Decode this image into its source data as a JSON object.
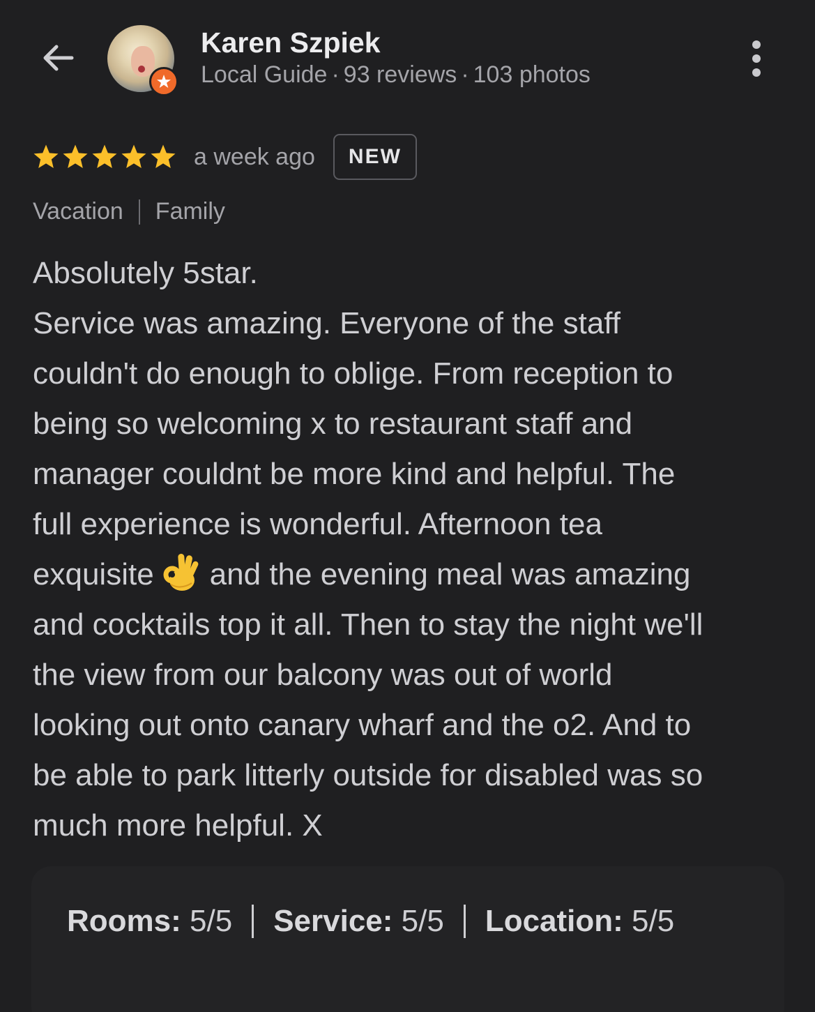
{
  "header": {
    "reviewer_name": "Karen Szpiek",
    "guide_label": "Local Guide",
    "reviews_count": "93 reviews",
    "photos_count": "103 photos",
    "separator": "·"
  },
  "review": {
    "rating": 5,
    "rating_max": 5,
    "time_ago": "a week ago",
    "badge": "NEW",
    "tags": [
      "Vacation",
      "Family"
    ],
    "lines": [
      "Absolutely 5star.",
      "Service was amazing. Everyone of the staff",
      "couldn't do enough to oblige. From reception to",
      "being so welcoming x to restaurant staff and",
      "manager couldnt be more kind and helpful. The",
      "full experience is wonderful. Afternoon tea",
      "exquisite",
      "and the evening meal was amazing",
      "and cocktails top it all. Then to stay the night we'll",
      "the view from our balcony was out of world",
      "looking out onto canary wharf and the o2. And to",
      "be able to park litterly outside for disabled was so",
      "much more helpful. X"
    ],
    "emoji": "ok-hand-emoji"
  },
  "subratings": [
    {
      "label": "Rooms:",
      "value": "5/5"
    },
    {
      "label": "Service:",
      "value": "5/5"
    },
    {
      "label": "Location:",
      "value": "5/5"
    }
  ],
  "colors": {
    "background": "#1f1f21",
    "star": "#fbbf2a",
    "badge_orange": "#f06a2a"
  },
  "icons": {
    "back": "back-arrow-icon",
    "more": "more-vert-icon",
    "star": "star-icon"
  }
}
